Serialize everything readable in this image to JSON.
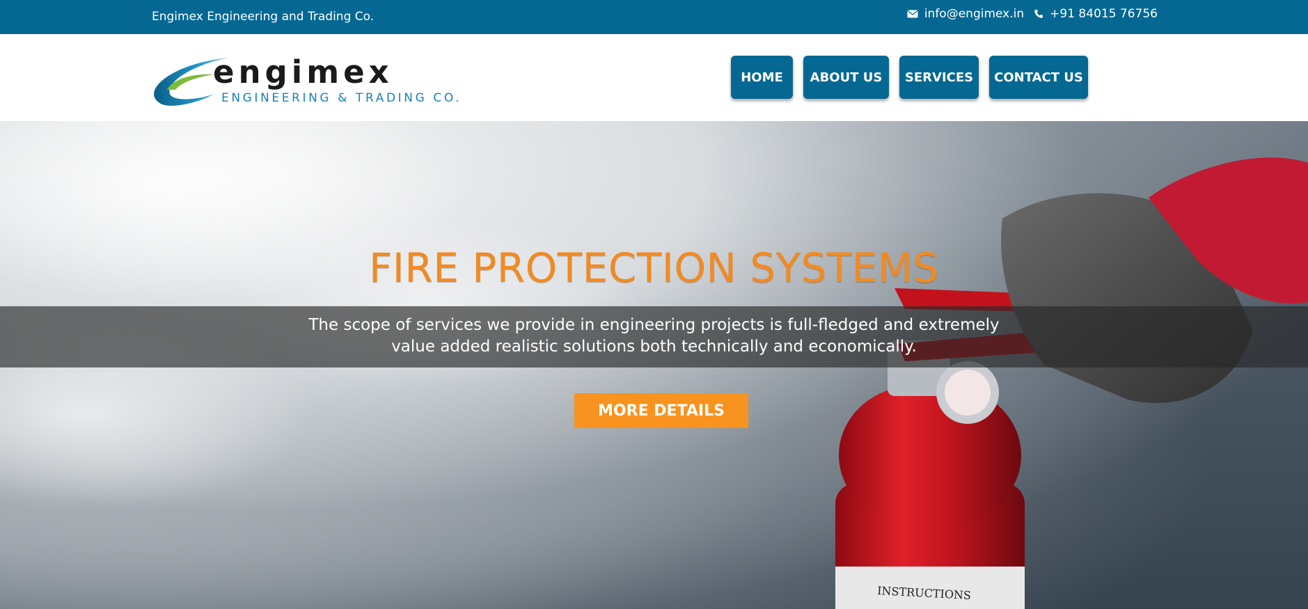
{
  "topbar": {
    "company_name": "Engimex Engineering and Trading Co.",
    "email": "info@engimex.in",
    "phone": "+91 84015 76756",
    "email_icon": "envelope-icon",
    "phone_icon": "phone-icon"
  },
  "logo": {
    "wordmark": "engimex",
    "tagline": "ENGINEERING & TRADING CO."
  },
  "nav": {
    "items": [
      "HOME",
      "ABOUT US",
      "SERVICES",
      "CONTACT US"
    ]
  },
  "hero": {
    "title": "FIRE PROTECTION SYSTEMS",
    "line1": "The scope of services we provide in engineering projects is full-fledged and extremely",
    "line2": "value added realistic solutions both technically and economically.",
    "cta_label": "MORE DETAILS"
  },
  "colors": {
    "brand_blue": "#056893",
    "accent_orange": "#f28a22",
    "cta_orange": "#f7931e"
  }
}
